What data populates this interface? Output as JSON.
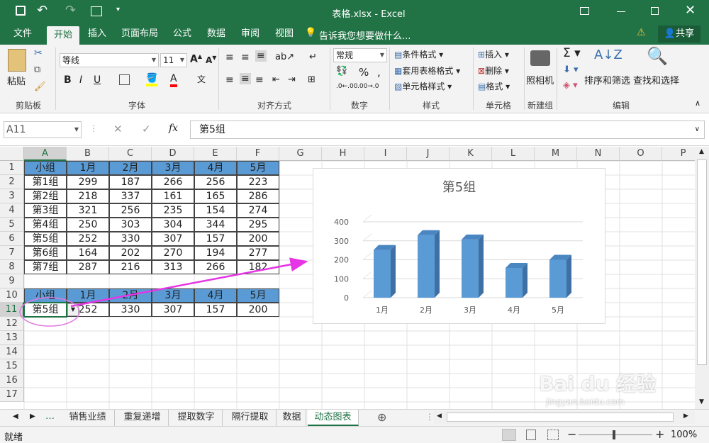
{
  "window": {
    "title": "表格.xlsx - Excel"
  },
  "tabs": [
    "文件",
    "开始",
    "插入",
    "页面布局",
    "公式",
    "数据",
    "审阅",
    "视图"
  ],
  "active_tab": "开始",
  "tell_me": "告诉我您想要做什么...",
  "share": "共享",
  "ribbon": {
    "paste": "粘贴",
    "font_name": "等线",
    "font_size": "11",
    "number_format": "常规",
    "conditional_format": "条件格式",
    "table_format": "套用表格格式",
    "cell_style": "单元格样式",
    "insert": "插入",
    "delete": "删除",
    "format": "格式",
    "camera": "照相机",
    "sort_filter": "排序和筛选",
    "find_select": "查找和选择",
    "groups": {
      "clipboard": "剪贴板",
      "font": "字体",
      "alignment": "对齐方式",
      "number": "数字",
      "styles": "样式",
      "cells": "单元格",
      "newgroup": "新建组",
      "editing": "编辑"
    }
  },
  "formula_bar": {
    "name_box": "A11",
    "content": "第5组",
    "fx": "fx"
  },
  "columns": [
    "A",
    "B",
    "C",
    "D",
    "E",
    "F",
    "G",
    "H",
    "I",
    "J",
    "K",
    "L",
    "M",
    "N",
    "O",
    "P"
  ],
  "rows": [
    "1",
    "2",
    "3",
    "4",
    "5",
    "6",
    "7",
    "8",
    "9",
    "10",
    "11",
    "12",
    "13",
    "14",
    "15",
    "16",
    "17"
  ],
  "table1": {
    "header": [
      "小组",
      "1月",
      "2月",
      "3月",
      "4月",
      "5月"
    ],
    "rows": [
      [
        "第1组",
        "299",
        "187",
        "266",
        "256",
        "223"
      ],
      [
        "第2组",
        "218",
        "337",
        "161",
        "165",
        "286"
      ],
      [
        "第3组",
        "321",
        "256",
        "235",
        "154",
        "274"
      ],
      [
        "第4组",
        "250",
        "303",
        "304",
        "344",
        "295"
      ],
      [
        "第5组",
        "252",
        "330",
        "307",
        "157",
        "200"
      ],
      [
        "第6组",
        "164",
        "202",
        "270",
        "194",
        "277"
      ],
      [
        "第7组",
        "287",
        "216",
        "313",
        "266",
        "182"
      ]
    ]
  },
  "table2": {
    "header": [
      "小组",
      "1月",
      "2月",
      "3月",
      "4月",
      "5月"
    ],
    "row": [
      "第5组",
      "252",
      "330",
      "307",
      "157",
      "200"
    ]
  },
  "chart_data": {
    "type": "bar",
    "title": "第5组",
    "categories": [
      "1月",
      "2月",
      "3月",
      "4月",
      "5月"
    ],
    "values": [
      252,
      330,
      307,
      157,
      200
    ],
    "yticks": [
      "0",
      "100",
      "200",
      "300",
      "400"
    ],
    "ylim": [
      0,
      400
    ],
    "color": "#5b9bd5",
    "grid": true
  },
  "sheet_tabs": [
    "销售业绩",
    "重复递增",
    "提取数字",
    "隔行提取",
    "数据",
    "动态图表"
  ],
  "active_sheet": "动态图表",
  "status": {
    "ready": "就绪",
    "zoom": "100%"
  },
  "watermark": {
    "brand": "Bai du 经验",
    "url": "jingyan.baidu.com"
  },
  "colors": {
    "excel_green": "#217346",
    "header_blue": "#5b9bd5",
    "arrow_magenta": "#e535e5"
  }
}
